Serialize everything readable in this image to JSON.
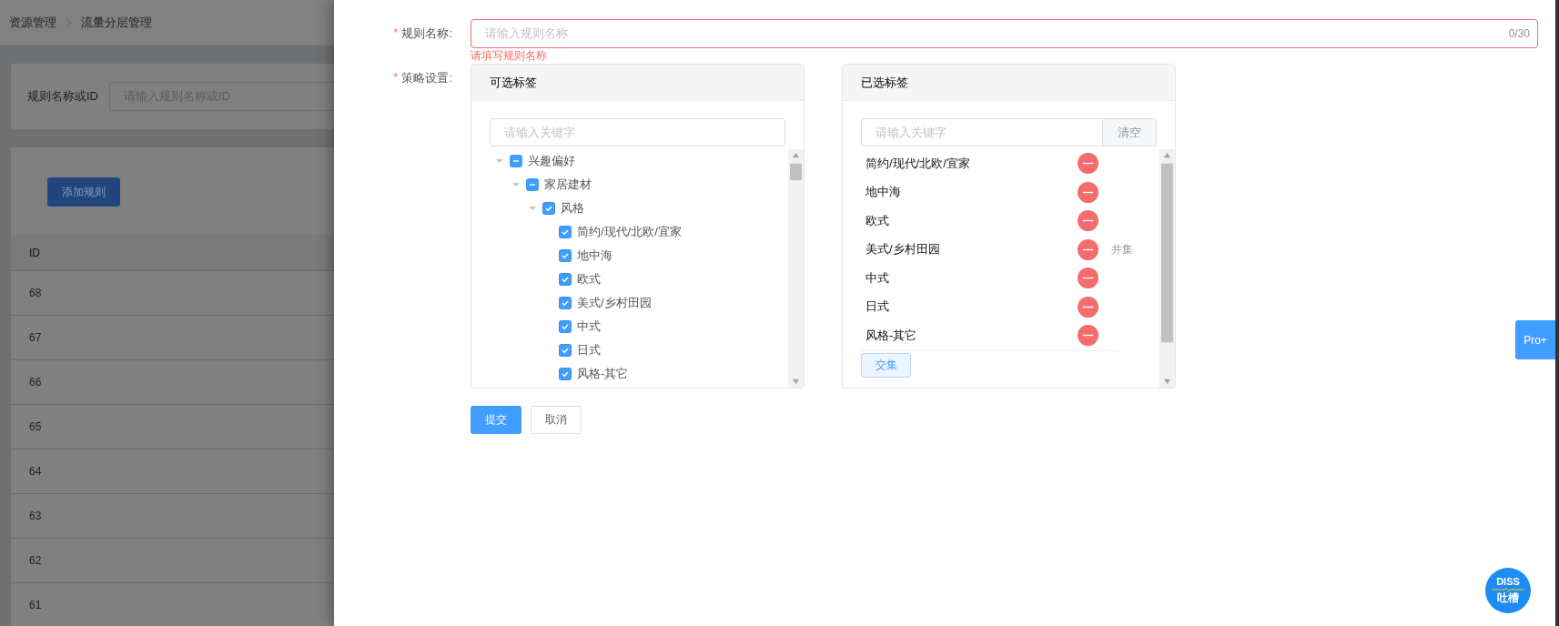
{
  "breadcrumb": [
    {
      "label": "资源管理"
    },
    {
      "label": "流量分层管理"
    }
  ],
  "filter": {
    "label": "规则名称或ID",
    "placeholder": "请输入规则名称或ID"
  },
  "add_button": "添加规则",
  "table": {
    "columns": [
      "ID"
    ],
    "rows": [
      "68",
      "67",
      "66",
      "65",
      "64",
      "63",
      "62",
      "61"
    ]
  },
  "drawer": {
    "name_field": {
      "required_mark": "*",
      "label": "规则名称:",
      "placeholder": "请输入规则名称",
      "counter": "0/30",
      "error": "请填写规则名称"
    },
    "strategy": {
      "required_mark": "*",
      "label": "策略设置:",
      "available": {
        "title": "可选标签",
        "search_placeholder": "请输入关键字",
        "tree": [
          {
            "label": "兴趣偏好",
            "checked": false,
            "indeterminate": true,
            "expanded": true,
            "children": [
              {
                "label": "家居建材",
                "checked": false,
                "indeterminate": true,
                "expanded": true,
                "children": [
                  {
                    "label": "风格",
                    "checked": true,
                    "indeterminate": false,
                    "expanded": true,
                    "children": [
                      {
                        "label": "简约/现代/北欧/宜家",
                        "checked": true,
                        "indeterminate": false
                      },
                      {
                        "label": "地中海",
                        "checked": true,
                        "indeterminate": false
                      },
                      {
                        "label": "欧式",
                        "checked": true,
                        "indeterminate": false
                      },
                      {
                        "label": "美式/乡村田园",
                        "checked": true,
                        "indeterminate": false
                      },
                      {
                        "label": "中式",
                        "checked": true,
                        "indeterminate": false
                      },
                      {
                        "label": "日式",
                        "checked": true,
                        "indeterminate": false
                      },
                      {
                        "label": "风格-其它",
                        "checked": true,
                        "indeterminate": false
                      }
                    ]
                  }
                ]
              }
            ]
          }
        ]
      },
      "chosen": {
        "title": "已选标签",
        "search_placeholder": "请输入关键字",
        "clear_button": "清空",
        "items": [
          {
            "label": "简约/现代/北欧/宜家"
          },
          {
            "label": "地中海"
          },
          {
            "label": "欧式"
          },
          {
            "label": "美式/乡村田园",
            "tag": "并集"
          },
          {
            "label": "中式"
          },
          {
            "label": "日式"
          },
          {
            "label": "风格-其它"
          }
        ],
        "footer_button": "交集"
      }
    },
    "submit_button": "提交",
    "cancel_button": "取消"
  },
  "side_tab": "Pro+",
  "feedback_badge": {
    "top": "DISS",
    "bottom": "吐槽"
  }
}
